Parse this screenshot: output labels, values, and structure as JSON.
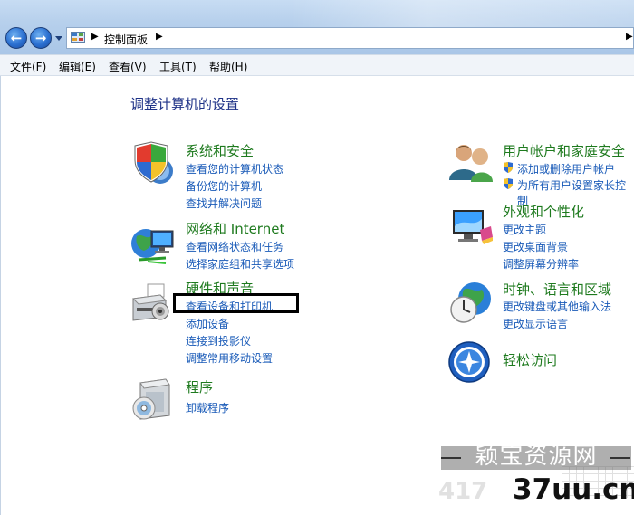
{
  "address": {
    "crumb": "控制面板"
  },
  "menu": [
    {
      "label": "文件(F)"
    },
    {
      "label": "编辑(E)"
    },
    {
      "label": "查看(V)"
    },
    {
      "label": "工具(T)"
    },
    {
      "label": "帮助(H)"
    }
  ],
  "page_heading": "调整计算机的设置",
  "left_categories": [
    {
      "title": "系统和安全",
      "icon": "shield-icon",
      "tasks": [
        "查看您的计算机状态",
        "备份您的计算机",
        "查找并解决问题"
      ]
    },
    {
      "title": "网络和 Internet",
      "icon": "network-globe-icon",
      "tasks": [
        "查看网络状态和任务",
        "选择家庭组和共享选项"
      ]
    },
    {
      "title": "硬件和声音",
      "icon": "printer-icon",
      "tasks": [
        "查看设备和打印机",
        "添加设备",
        "连接到投影仪",
        "调整常用移动设置"
      ]
    },
    {
      "title": "程序",
      "icon": "programs-icon",
      "tasks": [
        "卸载程序"
      ]
    }
  ],
  "right_categories": [
    {
      "title": "用户帐户和家庭安全",
      "icon": "users-icon",
      "tasks": [
        "添加或删除用户帐户",
        "为所有用户设置家长控制"
      ]
    },
    {
      "title": "外观和个性化",
      "icon": "monitor-icon",
      "tasks": [
        "更改主题",
        "更改桌面背景",
        "调整屏幕分辨率"
      ]
    },
    {
      "title": "时钟、语言和区域",
      "icon": "clock-globe-icon",
      "tasks": [
        "更改键盘或其他输入法",
        "更改显示语言"
      ]
    },
    {
      "title": "轻松访问",
      "icon": "accessibility-icon",
      "tasks": []
    }
  ],
  "watermark": {
    "cn": "颖宝资源网",
    "num": "417",
    "domain": "37uu.cn"
  },
  "colors": {
    "category_title": "#1e7a1e",
    "task_link": "#1a5bb8",
    "heading": "#1e3287",
    "highlight_border": "#000000"
  }
}
